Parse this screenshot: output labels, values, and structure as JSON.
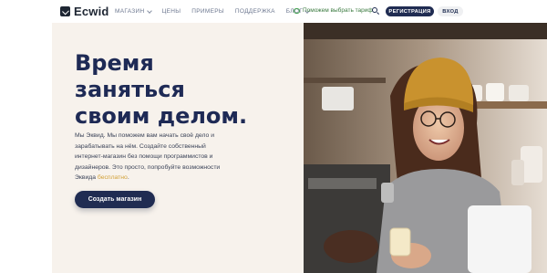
{
  "header": {
    "brand": "Ecwid",
    "nav": [
      {
        "label": "МАГАЗИН",
        "has_dropdown": true
      },
      {
        "label": "ЦЕНЫ",
        "has_dropdown": false
      },
      {
        "label": "ПРИМЕРЫ",
        "has_dropdown": false
      },
      {
        "label": "ПОДДЕРЖКА",
        "has_dropdown": false
      },
      {
        "label": "БЛОГ",
        "has_dropdown": true
      }
    ],
    "help_link": "Поможем выбрать тариф",
    "register_label": "РЕГИСТРАЦИЯ",
    "login_label": "ВХОД"
  },
  "hero": {
    "headline_line1": "Время",
    "headline_line2": "заняться",
    "headline_line3": "своим делом.",
    "description": "Мы Эквид. Мы поможем вам начать своё дело и зарабатывать на нём. Создайте собственный интернет-магазин без помощи программистов и дизайнеров. Это просто, попробуйте возможности Эквида",
    "description_link": "бесплатно",
    "description_end": ".",
    "cta_label": "Создать магазин"
  },
  "colors": {
    "brand_navy": "#202c52",
    "accent_link": "#d2a037",
    "hero_bg": "#f7f2ec",
    "help_green": "#3a7a3f"
  }
}
